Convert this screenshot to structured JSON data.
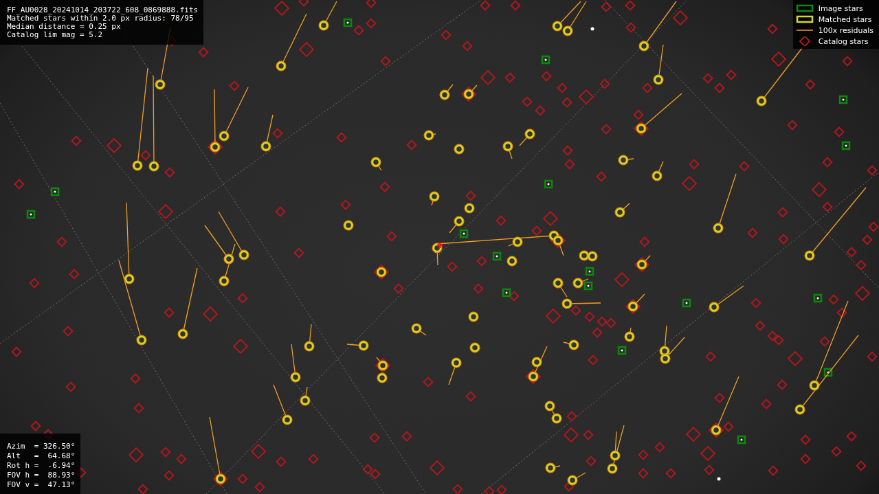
{
  "info_panel": {
    "lines": [
      "FF_AU0028_20241014_203722_608_0869888.fits",
      "Matched stars within 2.0 px radius: 78/95",
      "Median distance = 0.25 px",
      "Catalog lim mag = 5.2"
    ]
  },
  "legend": {
    "items": [
      {
        "kind": "image",
        "label": "Image stars"
      },
      {
        "kind": "matched",
        "label": "Matched stars"
      },
      {
        "kind": "residual",
        "label": "100x residuals"
      },
      {
        "kind": "catalog",
        "label": "Catalog stars"
      }
    ]
  },
  "pointing_panel": {
    "lines": [
      "Azim  = 326.50°",
      "Alt   =  64.68°",
      "Rot h =  -6.94°",
      "FOV h =  88.93°",
      "FOV v =  47.13°"
    ]
  }
}
